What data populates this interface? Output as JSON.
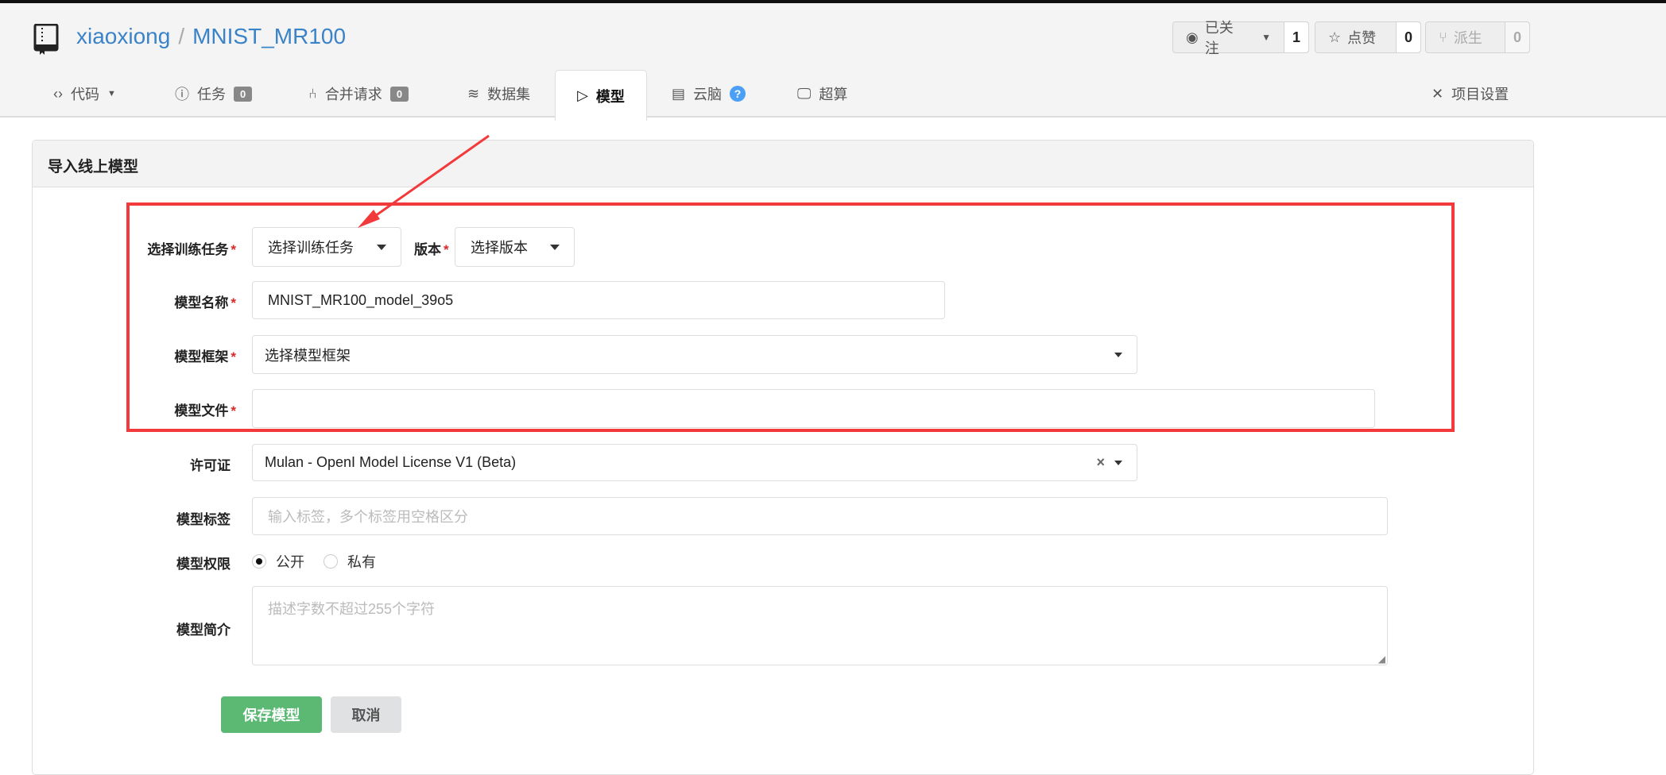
{
  "repo": {
    "owner": "xiaoxiong",
    "separator": "/",
    "name": "MNIST_MR100"
  },
  "actions": [
    {
      "label": "已关注",
      "count": "1",
      "icon": "eye-icon"
    },
    {
      "label": "点赞",
      "count": "0",
      "icon": "star-icon"
    },
    {
      "label": "派生",
      "count": "0",
      "icon": "fork-icon",
      "disabled": true
    }
  ],
  "tabs": [
    {
      "label": "代码",
      "icon": "code-icon"
    },
    {
      "label": "任务",
      "badge": "0",
      "icon": "issue-icon"
    },
    {
      "label": "合并请求",
      "badge": "0",
      "icon": "pull-request-icon"
    },
    {
      "label": "数据集",
      "icon": "layers-icon"
    },
    {
      "label": "模型",
      "icon": "play-icon",
      "active": true
    },
    {
      "label": "云脑",
      "icon": "server-icon",
      "help": "?"
    },
    {
      "label": "超算",
      "icon": "desktop-icon"
    }
  ],
  "settings_label": "项目设置",
  "panel_title": "导入线上模型",
  "form": {
    "required_mark": "*",
    "task_label": "选择训练任务",
    "task_value": "选择训练任务",
    "version_label": "版本",
    "version_value": "选择版本",
    "name_label": "模型名称",
    "name_value": "MNIST_MR100_model_39o5",
    "framework_label": "模型框架",
    "framework_value": "选择模型框架",
    "file_label": "模型文件",
    "file_value": "",
    "license_label": "许可证",
    "license_value": "Mulan - OpenI Model License V1 (Beta)",
    "license_clear": "×",
    "tags_label": "模型标签",
    "tags_placeholder": "输入标签，多个标签用空格区分",
    "permission_label": "模型权限",
    "public_label": "公开",
    "private_label": "私有",
    "desc_label": "模型简介",
    "desc_placeholder": "描述字数不超过255个字符",
    "save_label": "保存模型",
    "cancel_label": "取消"
  },
  "colors": {
    "accent": "#3b83c8",
    "annotation": "#f23a3c",
    "save": "#5bb974"
  }
}
